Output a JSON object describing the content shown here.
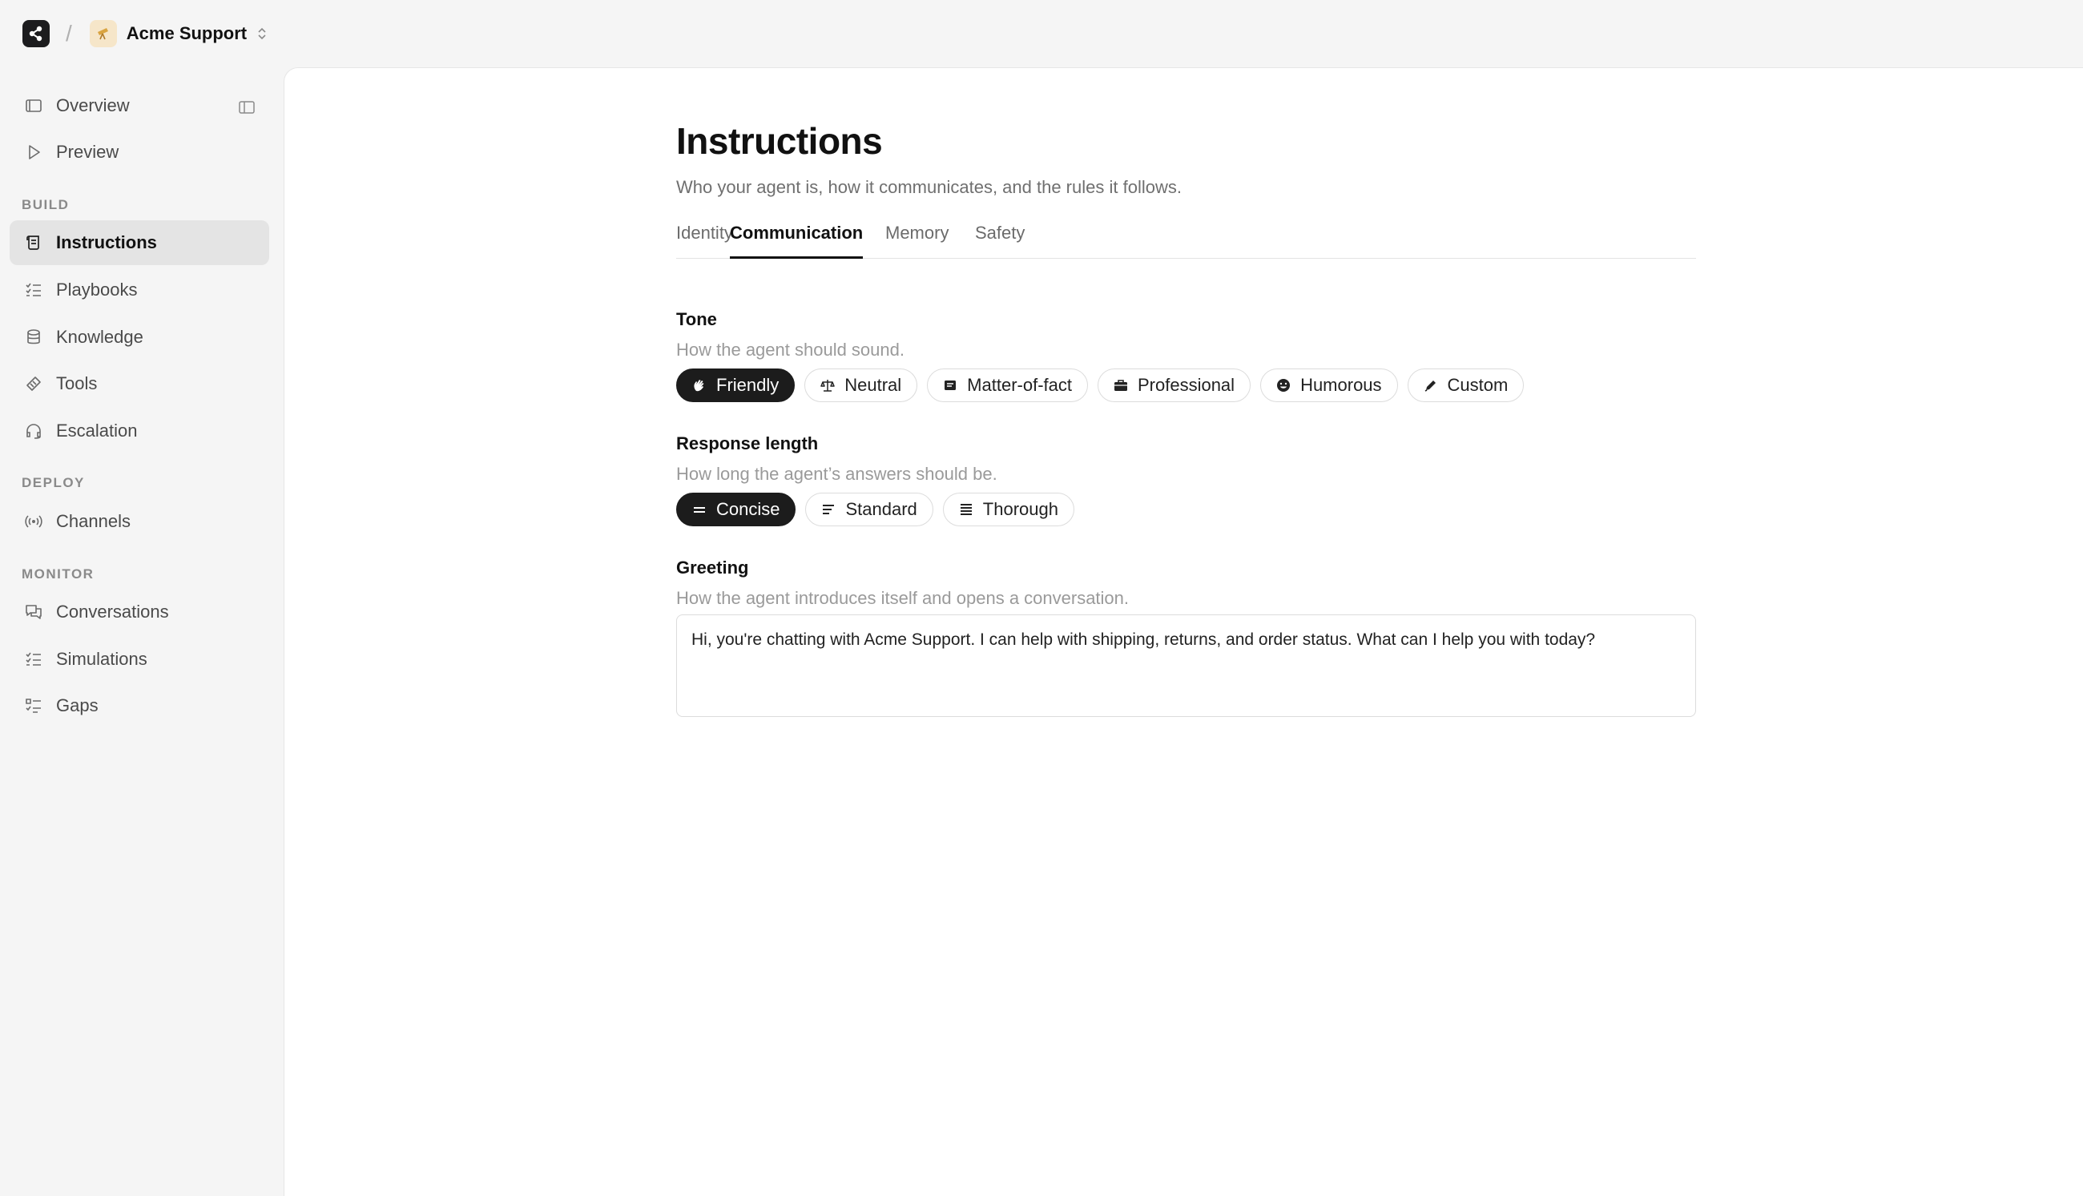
{
  "workspace": {
    "name": "Acme Support",
    "separator": "/",
    "avatar_icon": "telescope-icon"
  },
  "sidebar": {
    "top_items": [
      {
        "label": "Overview",
        "icon": "overview-icon"
      },
      {
        "label": "Preview",
        "icon": "play-icon"
      }
    ],
    "sections": [
      {
        "label": "BUILD",
        "items": [
          {
            "label": "Instructions",
            "icon": "scroll-icon",
            "active": true
          },
          {
            "label": "Playbooks",
            "icon": "checklist-icon"
          },
          {
            "label": "Knowledge",
            "icon": "database-icon"
          },
          {
            "label": "Tools",
            "icon": "tools-icon"
          },
          {
            "label": "Escalation",
            "icon": "headset-icon"
          }
        ]
      },
      {
        "label": "DEPLOY",
        "items": [
          {
            "label": "Channels",
            "icon": "broadcast-icon"
          }
        ]
      },
      {
        "label": "MONITOR",
        "items": [
          {
            "label": "Conversations",
            "icon": "chat-icon"
          },
          {
            "label": "Simulations",
            "icon": "checklist-icon"
          },
          {
            "label": "Gaps",
            "icon": "checklist-icon"
          }
        ]
      }
    ]
  },
  "page": {
    "title": "Instructions",
    "subtitle": "Who your agent is, how it communicates, and the rules it follows.",
    "tabs": [
      {
        "label": "Identity"
      },
      {
        "label": "Communication",
        "active": true
      },
      {
        "label": "Memory"
      },
      {
        "label": "Safety"
      }
    ],
    "tone": {
      "title": "Tone",
      "description": "How the agent should sound.",
      "options": [
        {
          "label": "Friendly",
          "icon": "waving-hand-icon",
          "selected": true
        },
        {
          "label": "Neutral",
          "icon": "scale-icon"
        },
        {
          "label": "Matter-of-fact",
          "icon": "document-icon"
        },
        {
          "label": "Professional",
          "icon": "briefcase-icon"
        },
        {
          "label": "Humorous",
          "icon": "smiley-icon"
        },
        {
          "label": "Custom",
          "icon": "pencil-icon"
        }
      ]
    },
    "response_length": {
      "title": "Response length",
      "description": "How long the agent’s answers should be.",
      "options": [
        {
          "label": "Concise",
          "icon": "two-lines-icon",
          "selected": true
        },
        {
          "label": "Standard",
          "icon": "three-lines-icon"
        },
        {
          "label": "Thorough",
          "icon": "four-lines-icon"
        }
      ]
    },
    "greeting": {
      "title": "Greeting",
      "description": "How the agent introduces itself and opens a conversation.",
      "value": "Hi, you're chatting with Acme Support. I can help with shipping, returns, and order status. What can I help you with today?"
    }
  }
}
